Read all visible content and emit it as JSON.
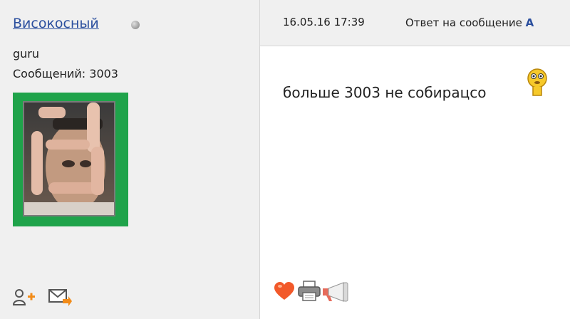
{
  "user": {
    "name": "Високосный",
    "rank": "guru",
    "posts_label": "Сообщений: 3003"
  },
  "post": {
    "datetime": "16.05.16 17:39",
    "reply_prefix": "Ответ на сообщение",
    "reply_link": "А",
    "text": "больше 3003 не собирацсо"
  },
  "icons": {
    "status": "offline-dot-icon",
    "add_friend": "add-friend-icon",
    "send_message": "send-message-icon",
    "like": "heart-icon",
    "print": "printer-icon",
    "report": "megaphone-icon",
    "smiley": "thinking-smiley-icon"
  },
  "colors": {
    "link": "#2b4f9e",
    "avatar_border": "#1fa34a",
    "panel": "#f0f0f0"
  }
}
